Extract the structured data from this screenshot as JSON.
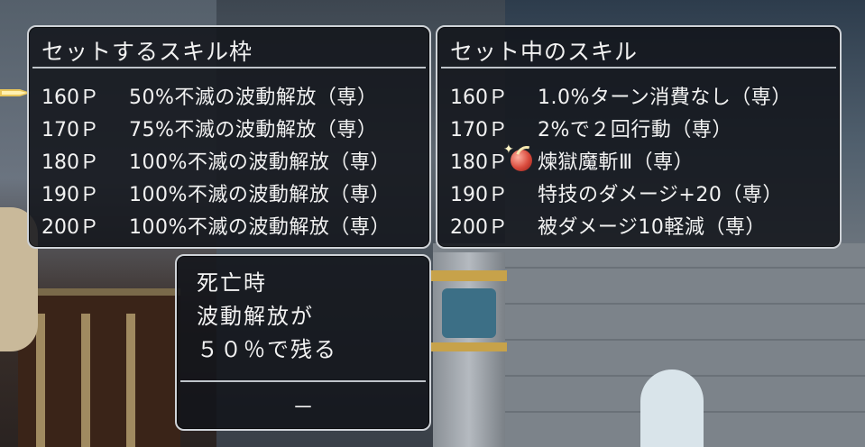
{
  "left_panel": {
    "title": "セットするスキル枠",
    "rows": [
      {
        "points": "160Ｐ",
        "skill": "50%不滅の波動解放（専）"
      },
      {
        "points": "170Ｐ",
        "skill": "75%不滅の波動解放（専）"
      },
      {
        "points": "180Ｐ",
        "skill": "100%不滅の波動解放（専）"
      },
      {
        "points": "190Ｐ",
        "skill": "100%不滅の波動解放（専）"
      },
      {
        "points": "200Ｐ",
        "skill": "100%不滅の波動解放（専）"
      }
    ]
  },
  "right_panel": {
    "title": "セット中のスキル",
    "rows": [
      {
        "points": "160Ｐ",
        "skill": "1.0%ターン消費なし（専）"
      },
      {
        "points": "170Ｐ",
        "skill": "2%で２回行動（専）"
      },
      {
        "points": "180Ｐ",
        "skill": "煉獄魔斬Ⅲ（専）",
        "icon": "red-orb-icon"
      },
      {
        "points": "190Ｐ",
        "skill": "特技のダメージ+20（専）"
      },
      {
        "points": "200Ｐ",
        "skill": "被ダメージ10軽減（専）"
      }
    ]
  },
  "description": {
    "lines": [
      "死亡時",
      "波動解放が",
      "５０％で残る"
    ],
    "footer": "－"
  },
  "colors": {
    "panel_bg": "#12141a",
    "panel_border": "#cfd3d8",
    "text": "#f2f2f2",
    "cursor": "#e9c65a"
  }
}
